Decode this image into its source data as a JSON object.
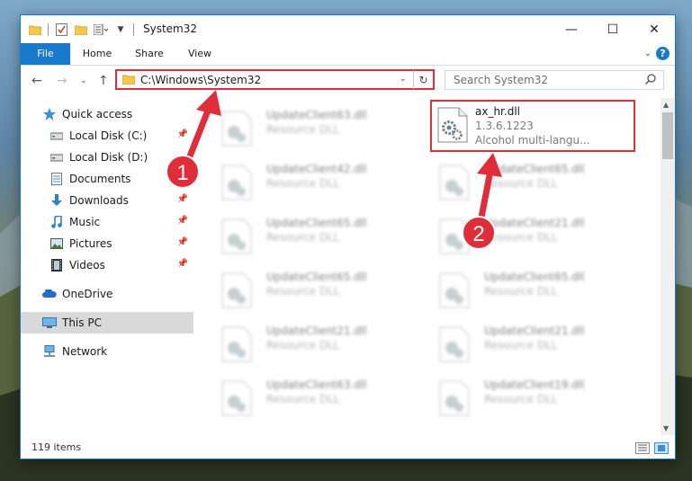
{
  "window": {
    "title": "System32",
    "minimize_glyph": "—",
    "maximize_glyph": "☐",
    "close_glyph": "✕"
  },
  "ribbon": {
    "tabs": [
      "File",
      "Home",
      "Share",
      "View"
    ],
    "help_glyph": "?"
  },
  "address": {
    "path": "C:\\Windows\\System32",
    "refresh_glyph": "↻",
    "search_placeholder": "Search System32"
  },
  "nav": {
    "items": [
      {
        "label": "Quick access",
        "icon": "star-icon",
        "pinned": false
      },
      {
        "label": "Local Disk (C:)",
        "icon": "drive-icon",
        "pinned": true
      },
      {
        "label": "Local Disk (D:)",
        "icon": "drive-icon",
        "pinned": false
      },
      {
        "label": "Documents",
        "icon": "documents-icon",
        "pinned": true
      },
      {
        "label": "Downloads",
        "icon": "download-icon",
        "pinned": true
      },
      {
        "label": "Music",
        "icon": "music-icon",
        "pinned": true
      },
      {
        "label": "Pictures",
        "icon": "pictures-icon",
        "pinned": true
      },
      {
        "label": "Videos",
        "icon": "videos-icon",
        "pinned": true
      },
      {
        "label": "OneDrive",
        "icon": "cloud-icon",
        "pinned": false
      },
      {
        "label": "This PC",
        "icon": "computer-icon",
        "pinned": false,
        "selected": true
      },
      {
        "label": "Network",
        "icon": "network-icon",
        "pinned": false
      }
    ]
  },
  "files": {
    "left": [
      {
        "name": "UpdateClient63.dll",
        "type": "Resource DLL"
      },
      {
        "name": "UpdateClient42.dll",
        "type": "Resource DLL"
      },
      {
        "name": "UpdateClient65.dll",
        "type": "Resource DLL"
      },
      {
        "name": "UpdateClient65.dll",
        "type": "Resource DLL"
      },
      {
        "name": "UpdateClient21.dll",
        "type": "Resource DLL"
      },
      {
        "name": "UpdateClient63.dll",
        "type": "Resource DLL"
      }
    ],
    "highlighted": {
      "name": "ax_hr.dll",
      "version": "1.3.6.1223",
      "description": "Alcohol multi-langu..."
    },
    "right": [
      {
        "name": "UpdateClient65.dll",
        "type": "Resource DLL"
      },
      {
        "name": "UpdateClient21.dll",
        "type": "Resource DLL"
      },
      {
        "name": "UpdateClient65.dll",
        "type": "Resource DLL"
      },
      {
        "name": "UpdateClient21.dll",
        "type": "Resource DLL"
      },
      {
        "name": "UpdateClient19.dll",
        "type": "Resource DLL"
      }
    ]
  },
  "status": {
    "item_count": "119 items"
  },
  "annotations": {
    "step1": "1",
    "step2": "2",
    "color": "#e02d3b"
  }
}
